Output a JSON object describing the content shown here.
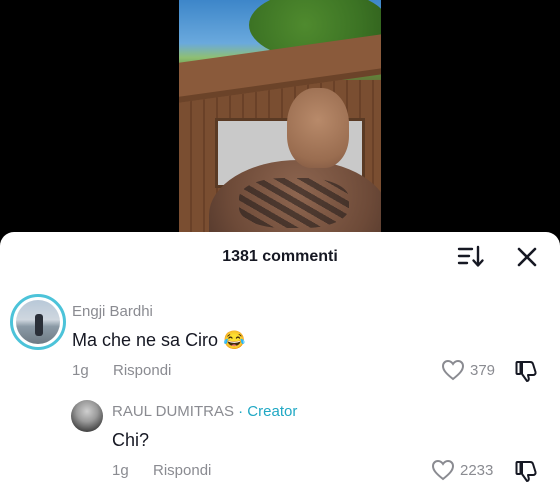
{
  "sheet": {
    "comment_count": "1381 commenti"
  },
  "comments": [
    {
      "username": "Engji Bardhi",
      "text": "Ma che ne sa Ciro 😂",
      "time": "1g",
      "reply_label": "Rispondi",
      "likes": "379"
    }
  ],
  "replies": [
    {
      "username": "RAUL DUMITRAS",
      "creator_label": "· Creator",
      "text": "Chi?",
      "time": "1g",
      "reply_label": "Rispondi",
      "likes": "2233"
    }
  ],
  "icons": {
    "sort": "sort-icon",
    "close": "close-icon",
    "like": "heart-icon",
    "dislike": "thumbs-down-icon"
  },
  "colors": {
    "creator_accent": "#20a8c4",
    "avatar_ring": "#4cc3d9",
    "text_primary": "#161823",
    "text_secondary": "#8a8b91"
  }
}
